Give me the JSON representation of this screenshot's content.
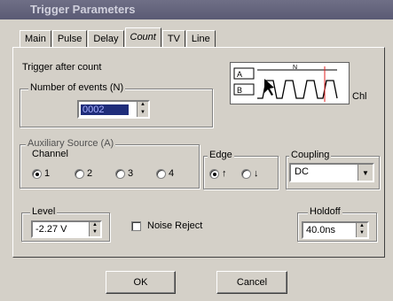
{
  "window": {
    "title": "Trigger Parameters"
  },
  "tabs": [
    {
      "label": "Main"
    },
    {
      "label": "Pulse"
    },
    {
      "label": "Delay"
    },
    {
      "label": "Count"
    },
    {
      "label": "TV"
    },
    {
      "label": "Line"
    }
  ],
  "active_tab": "Count",
  "count": {
    "heading": "Trigger after count",
    "events_group": "Number of events (N)",
    "events_value": "0002",
    "diagram": {
      "label_a": "A",
      "label_b": "B",
      "label_n": "N",
      "label_ch": "Chl"
    }
  },
  "aux": {
    "group": "Auxiliary Source (A)",
    "channel_label": "Channel",
    "channels": [
      "1",
      "2",
      "3",
      "4"
    ],
    "channel_selected": "1"
  },
  "edge": {
    "label": "Edge",
    "rising": "↑",
    "falling": "↓"
  },
  "coupling": {
    "label": "Coupling",
    "value": "DC"
  },
  "level": {
    "label": "Level",
    "value": "-2.27 V"
  },
  "noise_reject": {
    "label": "Noise Reject",
    "checked": false
  },
  "holdoff": {
    "label": "Holdoff",
    "value": "40.0ns"
  },
  "buttons": {
    "ok": "OK",
    "cancel": "Cancel"
  }
}
